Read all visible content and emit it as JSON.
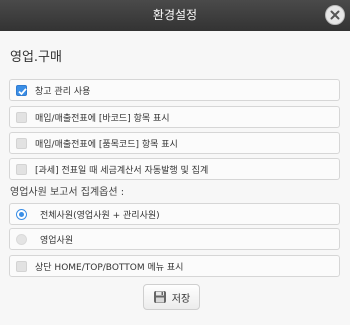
{
  "window": {
    "title": "환경설정"
  },
  "section": {
    "title": "영업.구매"
  },
  "options": [
    {
      "label": "창고 관리 사용",
      "checked": true
    },
    {
      "label": "매입/매출전표에 [바코드] 항목 표시",
      "checked": false
    },
    {
      "label": "매입/매출전표에 [품목코드] 항목 표시",
      "checked": false
    },
    {
      "label": "[과세] 전표일 때 세금계산서 자동발행 및 집계",
      "checked": false
    }
  ],
  "report_options": {
    "label": "영업사원 보고서 집계옵션 :",
    "choices": [
      {
        "label": "전체사원(영업사원 + 관리사원)",
        "selected": true
      },
      {
        "label": "영업사원",
        "selected": false
      }
    ]
  },
  "menu_option": {
    "label": "상단 HOME/TOP/BOTTOM 메뉴 표시",
    "checked": false
  },
  "actions": {
    "save_label": "저장"
  },
  "icons": {
    "close": "close-icon",
    "check": "check-icon",
    "save": "save-icon"
  },
  "colors": {
    "titlebar": "#3a3a3a",
    "accent": "#3a8ee6"
  }
}
